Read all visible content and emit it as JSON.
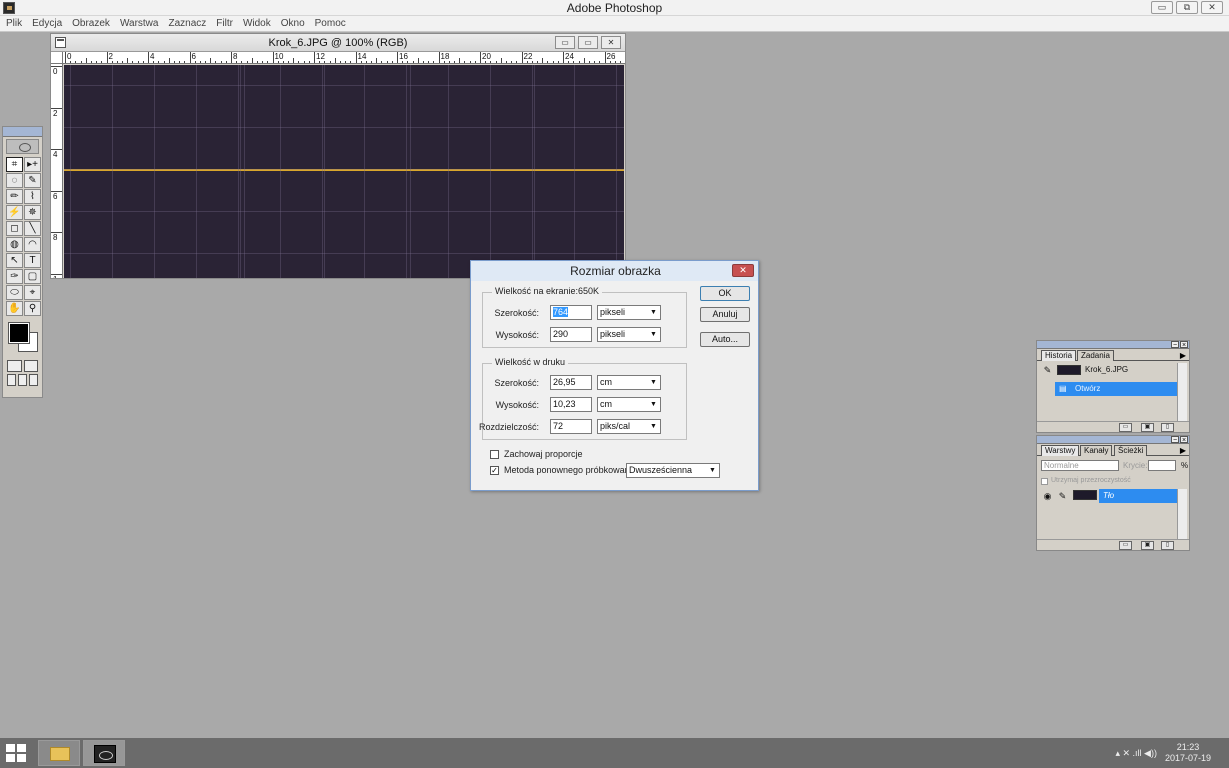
{
  "app": {
    "title": "Adobe Photoshop",
    "window_controls": [
      "▭",
      "⧉",
      "✕"
    ]
  },
  "menu": [
    "Plik",
    "Edycja",
    "Obrazek",
    "Warstwa",
    "Zaznacz",
    "Filtr",
    "Widok",
    "Okno",
    "Pomoc"
  ],
  "document": {
    "title": "Krok_6.JPG @ 100% (RGB)",
    "controls": [
      "▭",
      "▭",
      "✕"
    ],
    "ruler_h_labels": [
      "0",
      "2",
      "4",
      "6",
      "8",
      "10",
      "12",
      "14",
      "16",
      "18",
      "20",
      "22",
      "24",
      "26"
    ],
    "ruler_v_labels": [
      "0",
      "2",
      "4",
      "6",
      "8",
      "1"
    ]
  },
  "toolbox": {
    "tools": [
      "⌗",
      "▸+",
      "◌",
      "✎",
      "✏",
      "⌇",
      "⚡",
      "✵",
      "◻",
      "╲",
      "◍",
      "◠",
      "↖",
      "T",
      "✑",
      "▢",
      "⬭",
      "⌖",
      "✋",
      "⚲"
    ]
  },
  "dialog": {
    "title": "Rozmiar obrazka",
    "close": "✕",
    "screen_group": "Wielkość na ekranie:650K",
    "width_label": "Szerokość:",
    "width_value": "764",
    "width_unit": "pikseli",
    "height_label": "Wysokość:",
    "height_value": "290",
    "height_unit": "pikseli",
    "print_group": "Wielkość w druku",
    "print_width_label": "Szerokość:",
    "print_width_value": "26,95",
    "print_width_unit": "cm",
    "print_height_label": "Wysokość:",
    "print_height_value": "10,23",
    "print_height_unit": "cm",
    "resolution_label": "Rozdzielczość:",
    "resolution_value": "72",
    "resolution_unit": "piks/cal",
    "constrain_label": "Zachowaj proporcje",
    "constrain_checked": false,
    "resample_label": "Metoda ponownego próbkowania:",
    "resample_checked": true,
    "resample_method": "Dwusześcienna",
    "ok": "OK",
    "cancel": "Anuluj",
    "auto": "Auto..."
  },
  "history_palette": {
    "tabs": [
      "Historia",
      "Zadania"
    ],
    "snapshot": "Krok_6.JPG",
    "step": "Otwórz"
  },
  "layers_palette": {
    "tabs": [
      "Warstwy",
      "Kanały",
      "Ścieżki"
    ],
    "blend_mode": "Normalne",
    "opacity_label": "Krycie:",
    "opacity_unit": "%",
    "preserve_label": "Utrzymaj przezroczystość",
    "layer_name": "Tło"
  },
  "taskbar": {
    "time": "21:23",
    "date": "2017-07-19",
    "tray_icons": "▴ ✕ .ıll ◀))"
  }
}
